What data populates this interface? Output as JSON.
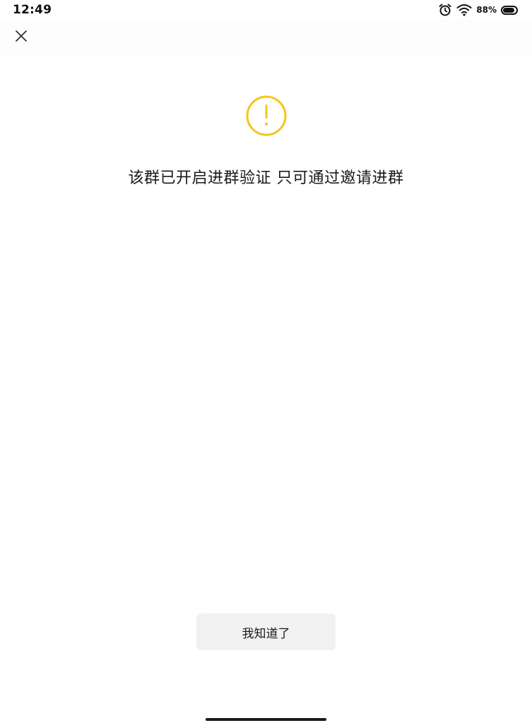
{
  "status_bar": {
    "time": "12:49",
    "battery_percent": "88%",
    "battery_level": 0.88,
    "icons": [
      "alarm-icon",
      "wifi-icon",
      "battery-icon"
    ]
  },
  "top_bar": {
    "close_icon": "close-icon"
  },
  "dialog": {
    "icon": "warning-icon",
    "icon_color": "#F5C518",
    "message": "该群已开启进群验证 只可通过邀请进群",
    "confirm_label": "我知道了"
  }
}
